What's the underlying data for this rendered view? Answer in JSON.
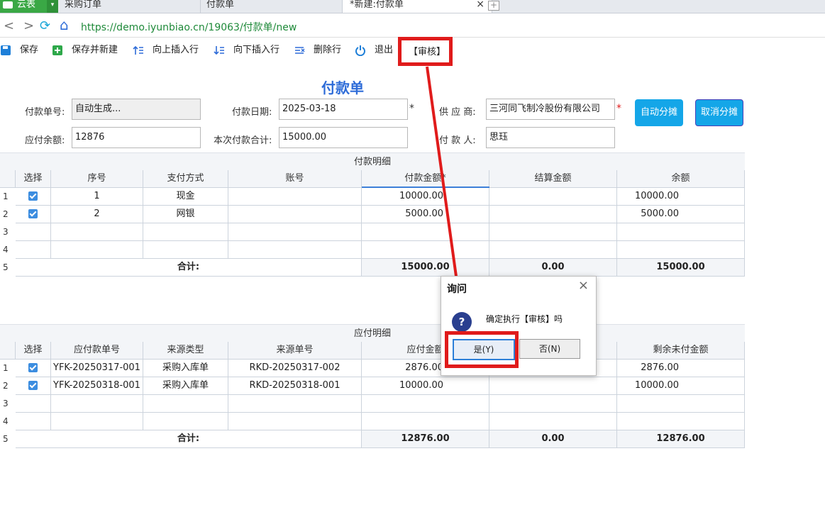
{
  "tabs": {
    "app_label": "云表",
    "purchase_order": "采购订单",
    "payment": "付款单",
    "new_payment": "*新建:付款单",
    "close": "×",
    "add": "+"
  },
  "address": {
    "back": "<",
    "forward": ">",
    "refresh": "⟳",
    "home": "⌂",
    "url": "https://demo.iyunbiao.cn/19063/付款单/new"
  },
  "toolbar": {
    "save": "保存",
    "save_new": "保存并新建",
    "insert_above": "向上插入行",
    "insert_below": "向下插入行",
    "delete_row": "删除行",
    "exit": "退出",
    "audit": "【审核】"
  },
  "form": {
    "title": "付款单",
    "doc_no_label": "付款单号:",
    "doc_no_value": "自动生成...",
    "date_label": "付款日期:",
    "date_value": "2025-03-18",
    "supplier_label": "供 应 商:",
    "supplier_value": "三河同飞制冷股份有限公司",
    "balance_label": "应付余额:",
    "balance_value": "12876",
    "total_label": "本次付款合计:",
    "total_value": "15000.00",
    "payer_label": "付 款 人:",
    "payer_value": "思珏",
    "required_mark": "*",
    "auto_alloc": "自动分摊",
    "cancel_alloc": "取消分摊"
  },
  "payment_detail": {
    "title": "付款明细",
    "headers": [
      "选择",
      "序号",
      "支付方式",
      "账号",
      "付款金额*",
      "结算金额",
      "余额"
    ],
    "row_numbers": [
      "1",
      "2",
      "3",
      "4",
      "5"
    ],
    "rows": [
      {
        "seq": "1",
        "method": "现金",
        "account": "",
        "amount": "10000.00",
        "settled": "",
        "balance": "10000.00"
      },
      {
        "seq": "2",
        "method": "网银",
        "account": "",
        "amount": "5000.00",
        "settled": "",
        "balance": "5000.00"
      }
    ],
    "total_label": "合计:",
    "total_amount": "15000.00",
    "total_settled": "0.00",
    "total_balance": "15000.00"
  },
  "payable_detail": {
    "title": "应付明细",
    "headers": [
      "选择",
      "应付款单号",
      "来源类型",
      "来源单号",
      "应付金额",
      "",
      "剩余未付金额"
    ],
    "row_numbers": [
      "1",
      "2",
      "3",
      "4",
      "5"
    ],
    "rows": [
      {
        "doc": "YFK-20250317-001",
        "src_type": "采购入库单",
        "src_no": "RKD-20250317-002",
        "amount": "2876.00",
        "remain": "2876.00"
      },
      {
        "doc": "YFK-20250318-001",
        "src_type": "采购入库单",
        "src_no": "RKD-20250318-001",
        "amount": "10000.00",
        "remain": "10000.00"
      }
    ],
    "total_label": "合计:",
    "total_amount": "12876.00",
    "total_mid": "0.00",
    "total_remain": "12876.00"
  },
  "dialog": {
    "title": "询问",
    "close": "×",
    "icon": "?",
    "message": "确定执行【审核】吗",
    "yes": "是(Y)",
    "no": "否(N)"
  },
  "colors": {
    "highlight": "#e01b1b",
    "title_blue": "#2e6cd8",
    "button_blue": "#14a6e8",
    "url_green": "#1f8a3a"
  }
}
